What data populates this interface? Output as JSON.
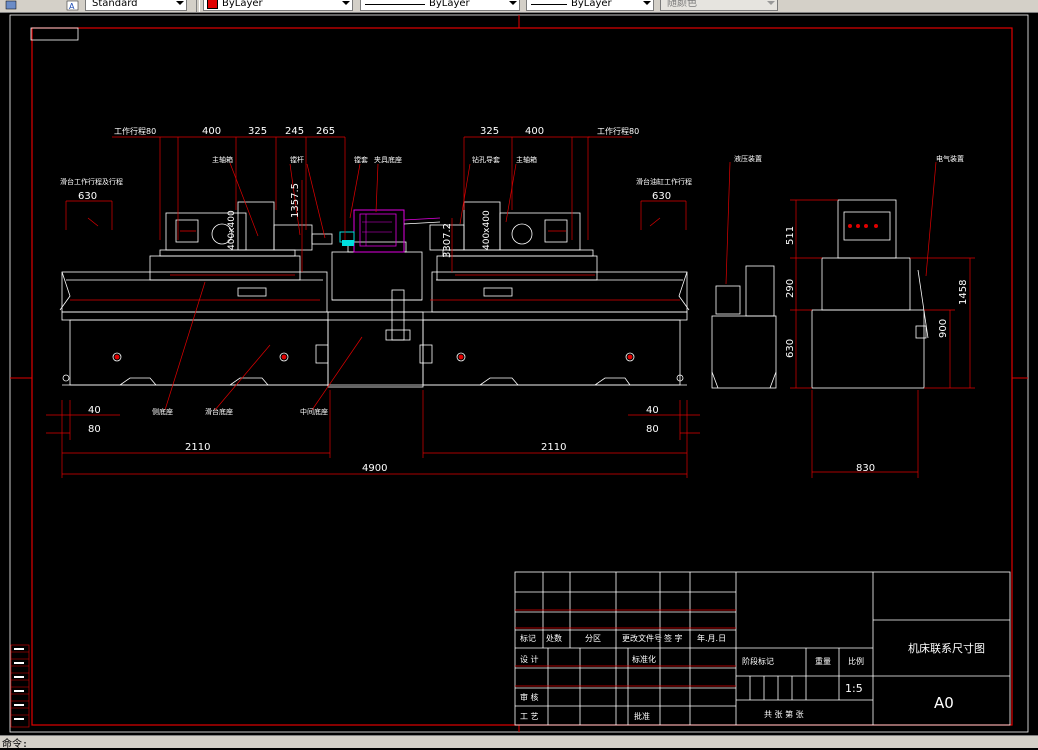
{
  "toolbar": {
    "text_style": "Standard",
    "layer_color": "ByLayer",
    "linetype": "ByLayer",
    "lineweight": "ByLayer",
    "plot_style": "随颜色",
    "colors": {
      "face": "#d4d0c8",
      "swatch": "#e00000"
    }
  },
  "drawing": {
    "dims": {
      "tool_stroke_left": "工作行程80",
      "tool_stroke_right": "工作行程80",
      "d400_l": "400",
      "d325_l": "325",
      "d245": "245",
      "d265": "265",
      "d325_r": "325",
      "d400_r": "400",
      "d630_l": "630",
      "d630_r": "630",
      "d1357": "1357.5",
      "d3307": "3307.2",
      "box_l": "400x400",
      "box_r": "400x400",
      "d40_l": "40",
      "d80_l": "80",
      "d40_r": "40",
      "d80_r": "80",
      "d2110_l": "2110",
      "d2110_r": "2110",
      "d4900": "4900",
      "d511": "511",
      "d290": "290",
      "d630_v": "630",
      "d1458": "1458",
      "d900": "900",
      "d830": "830"
    },
    "labels": {
      "spindle_box_l": "主轴箱",
      "spindle_box_r": "主轴箱",
      "boring_bar": "镗杆",
      "guide": "镗套",
      "fixture": "夹具底座",
      "hydraulic_l": "滑台工作行程及行程",
      "hydraulic_r": "滑台油缸工作行程",
      "hydraulic_station": "液压装置",
      "electrical": "电气装置",
      "base": "侧底座",
      "slide": "滑台底座",
      "middle_base": "中间底座",
      "spindle_guide": "钻孔导套"
    }
  },
  "title_block": {
    "headers": [
      "标记",
      "处数",
      "分区",
      "更改文件号",
      "签 字",
      "年.月.日"
    ],
    "rows": [
      "设 计",
      "标准化",
      "审 核",
      "工 艺"
    ],
    "approve": "批准",
    "stage_mark": "阶段标记",
    "weight": "重量",
    "scale_label": "比例",
    "scale": "1:5",
    "title": "机床联系尺寸图",
    "sheet_size": "A0",
    "sheets": "共  张  第  张"
  },
  "statusbar": {
    "command": "命令:"
  }
}
